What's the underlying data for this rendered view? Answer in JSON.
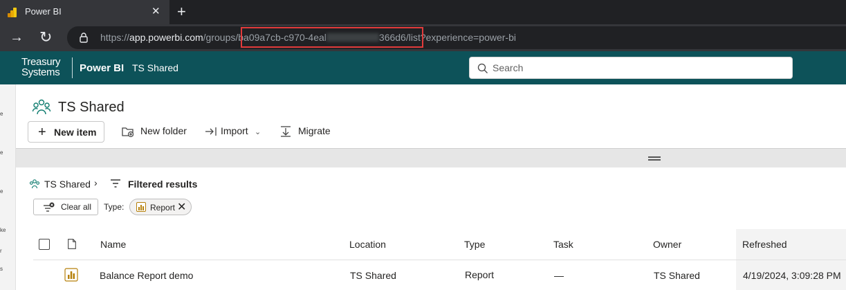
{
  "browser": {
    "tab_title": "Power BI",
    "tab_close": "✕",
    "new_tab": "+",
    "url_prefix": "https://",
    "url_host": "app.powerbi.com",
    "url_path_start": "/groups/",
    "url_id_visible_start": "ba09a7cb-c970-4eal",
    "url_id_visible_end": "366d6",
    "url_suffix": "/list?experience=power-bi",
    "highlight_color": "#e23b3b"
  },
  "header": {
    "brand_line1": "Treasury",
    "brand_line2": "Systems",
    "app_name": "Power BI",
    "workspace": "TS Shared",
    "search_placeholder": "Search",
    "bg_color": "#0d5259"
  },
  "workspace": {
    "title": "TS Shared"
  },
  "toolbar": {
    "new_item": "New item",
    "new_folder": "New folder",
    "import": "Import",
    "migrate": "Migrate"
  },
  "breadcrumb": {
    "workspace": "TS Shared",
    "separator": "›",
    "current": "Filtered results"
  },
  "filters": {
    "clear_all": "Clear all",
    "type_label": "Type:",
    "type_value": "Report"
  },
  "table": {
    "columns": {
      "name": "Name",
      "location": "Location",
      "type": "Type",
      "task": "Task",
      "owner": "Owner",
      "refreshed": "Refreshed"
    },
    "rows": [
      {
        "name": "Balance Report demo",
        "location": "TS Shared",
        "type": "Report",
        "task": "—",
        "owner": "TS Shared",
        "refreshed": "4/19/2024, 3:09:28 PM"
      }
    ]
  },
  "left_rail": {
    "marks": [
      "e",
      "e",
      "e",
      "ke",
      "r",
      "s"
    ]
  }
}
